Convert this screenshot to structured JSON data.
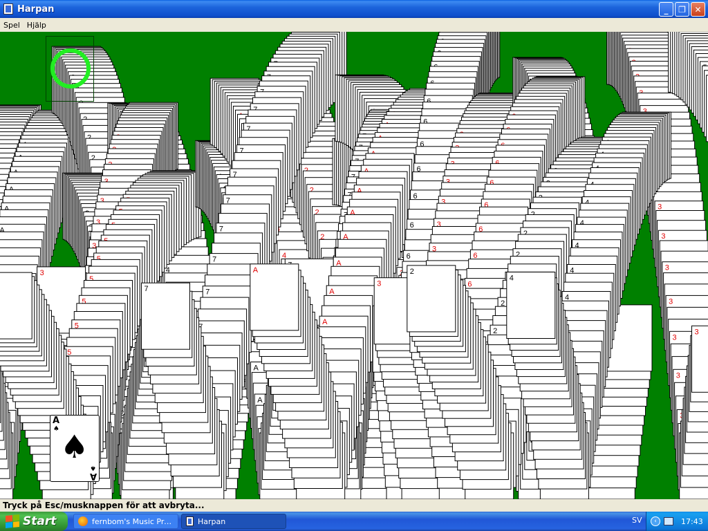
{
  "window": {
    "title": "Harpan",
    "minimize_glyph": "_",
    "maximize_glyph": "❐",
    "close_glyph": "✕"
  },
  "menu": {
    "items": [
      "Spel",
      "Hjälp"
    ]
  },
  "board": {
    "background_color": "#008000",
    "deck_ring_color": "#22ee22",
    "final_card": {
      "rank": "A",
      "suit": "♠"
    },
    "trail_ranks": [
      "A",
      "2",
      "3",
      "4",
      "5",
      "6",
      "7"
    ]
  },
  "status": {
    "text": "Tryck på Esc/musknappen för att avbryta..."
  },
  "taskbar": {
    "start_label": "Start",
    "tasks": [
      {
        "label": "fernbom's Music Profil...",
        "icon": "firefox-icon",
        "active": false
      },
      {
        "label": "Harpan",
        "icon": "solitaire-icon",
        "active": true
      }
    ],
    "language": "SV",
    "clock": "17:43"
  }
}
